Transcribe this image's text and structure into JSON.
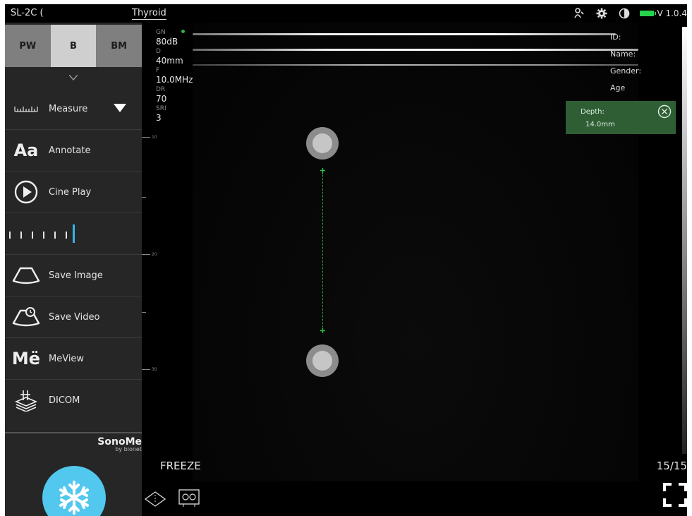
{
  "topbar": {
    "probe_label": "SL-2C (",
    "preset_label": "Thyroid",
    "version": "V 1.0.4",
    "icons": [
      "user-icon",
      "gear-icon",
      "contrast-icon",
      "battery-icon"
    ]
  },
  "sidebar": {
    "mode_tabs": [
      {
        "label": "PW",
        "active": false
      },
      {
        "label": "B",
        "active": true
      },
      {
        "label": "BM",
        "active": false
      }
    ],
    "menu": [
      {
        "label": "Measure",
        "icon": "ruler-icon"
      },
      {
        "label": "Annotate",
        "icon": "aa-text-icon"
      },
      {
        "label": "Cine Play",
        "icon": "play-circle-icon"
      },
      {
        "label": "Save Image",
        "icon": "probe-image-icon"
      },
      {
        "label": "Save Video",
        "icon": "probe-video-icon"
      },
      {
        "label": "MeView",
        "icon": "meview-icon"
      },
      {
        "label": "DICOM",
        "icon": "dicom-icon"
      }
    ],
    "brand": "SonoMe",
    "brand_sub": "by bionet"
  },
  "image": {
    "params": [
      {
        "label": "GN",
        "value": "80dB"
      },
      {
        "label": "D",
        "value": "40mm"
      },
      {
        "label": "F",
        "value": "10.0MHz"
      },
      {
        "label": "DR",
        "value": "70"
      },
      {
        "label": "SRI",
        "value": "3"
      }
    ],
    "ruler_labels": [
      "10",
      "20",
      "30"
    ],
    "patient": {
      "id_label": "ID:",
      "name_label": "Name:",
      "gender_label": "Gender:",
      "age_label": "Age"
    },
    "measurement": {
      "label": "Depth:",
      "value": "14.0mm",
      "color": "#2f5e35"
    },
    "freeze_label": "FREEZE",
    "frame_counter": "15/15"
  },
  "colors": {
    "accent_blue": "#53c8ee",
    "measure_green": "#2cc04a",
    "battery_green": "#27d24c"
  }
}
